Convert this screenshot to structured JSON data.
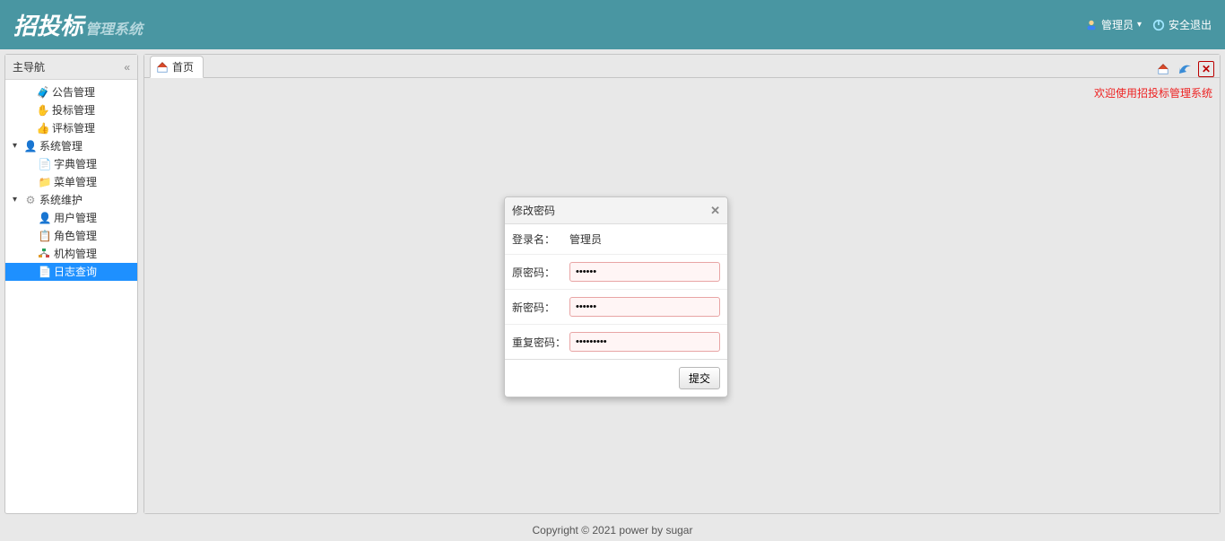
{
  "brand": {
    "strong": "招投标",
    "sub": "管理系统"
  },
  "topbar": {
    "admin_label": "管理员",
    "logout_label": "安全退出"
  },
  "sidebar": {
    "title": "主导航",
    "items": [
      {
        "label": "公告管理"
      },
      {
        "label": "投标管理"
      },
      {
        "label": "评标管理"
      },
      {
        "label": "系统管理"
      },
      {
        "label": "字典管理"
      },
      {
        "label": "菜单管理"
      },
      {
        "label": "系统维护"
      },
      {
        "label": "用户管理"
      },
      {
        "label": "角色管理"
      },
      {
        "label": "机构管理"
      },
      {
        "label": "日志查询"
      }
    ]
  },
  "tabs": {
    "home_label": "首页"
  },
  "welcome": "欢迎使用招投标管理系统",
  "dialog": {
    "title": "修改密码",
    "login_label": "登录名：",
    "login_value": "管理员",
    "old_pw_label": "原密码：",
    "new_pw_label": "新密码：",
    "repeat_pw_label": "重复密码：",
    "submit_label": "提交"
  },
  "footer": "Copyright © 2021 power by sugar"
}
